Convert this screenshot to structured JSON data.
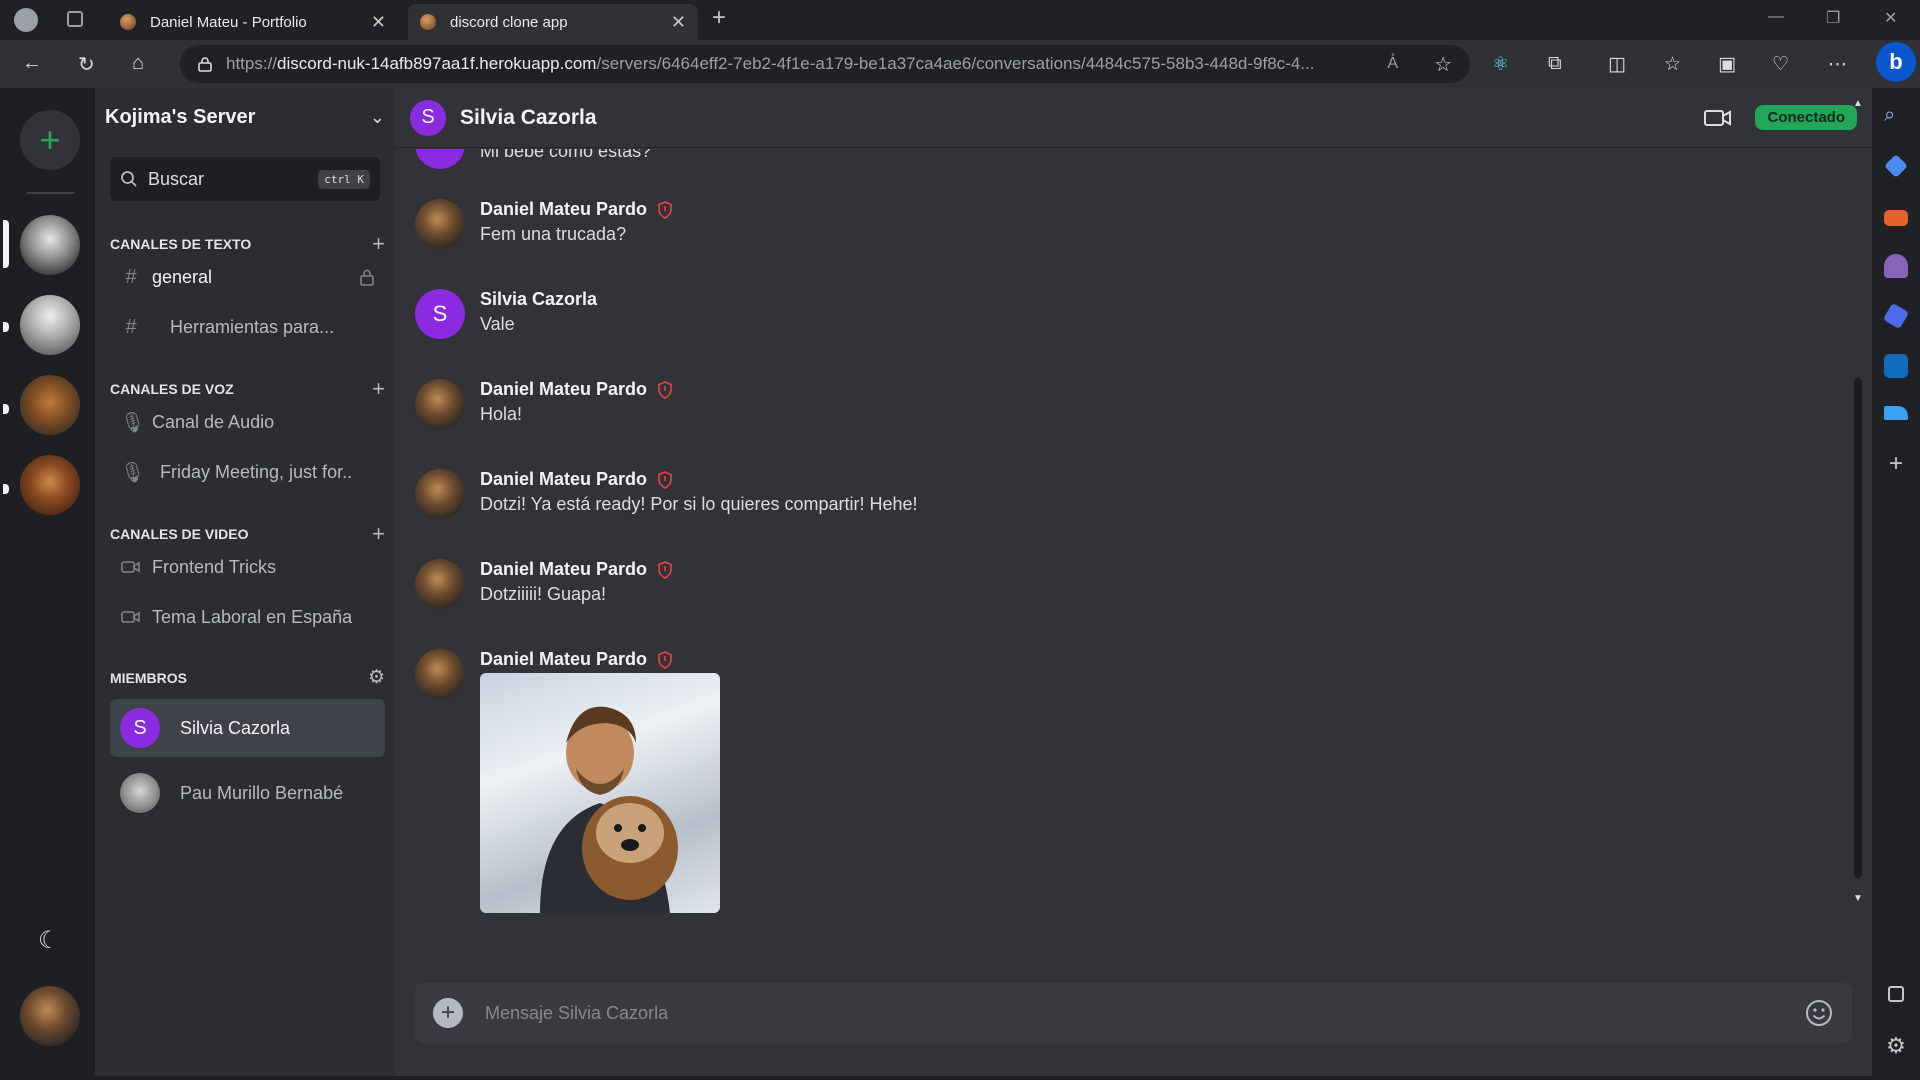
{
  "browser": {
    "tabs": [
      {
        "title": "Daniel Mateu - Portfolio"
      },
      {
        "title": "discord clone app"
      }
    ],
    "url_scheme": "https://",
    "url_host": "discord-nuk-14afb897aa1f.herokuapp.com",
    "url_path": "/servers/6464eff2-7eb2-4f1e-a179-be1a37ca4ae6/conversations/4484c575-58b3-448d-9f8c-4..."
  },
  "app": {
    "server_name": "Kojima's Server",
    "search": {
      "label": "Buscar",
      "shortcut": "ctrl K"
    },
    "sections": {
      "text": "CANALES DE TEXTO",
      "voice": "CANALES DE VOZ",
      "video": "CANALES DE VIDEO",
      "members": "MIEMBROS"
    },
    "text_channels": [
      {
        "name": "general"
      },
      {
        "name": "Herramientas para..."
      }
    ],
    "voice_channels": [
      {
        "name": "Canal de Audio"
      },
      {
        "name": "Friday Meeting, just for.."
      }
    ],
    "video_channels": [
      {
        "name": "Frontend Tricks"
      },
      {
        "name": "Tema Laboral en España"
      }
    ],
    "members": [
      {
        "name": "Silvia Cazorla",
        "initial": "S"
      },
      {
        "name": "Pau Murillo Bernabé"
      }
    ],
    "chat": {
      "title": "Silvia Cazorla",
      "initial": "S",
      "status": "Conectado",
      "partial_text": "Mi bebe como estas?",
      "messages": [
        {
          "author": "Daniel Mateu Pardo",
          "text": "Fem una trucada?",
          "admin": true
        },
        {
          "author": "Silvia Cazorla",
          "text": "Vale",
          "admin": false,
          "initial": "S"
        },
        {
          "author": "Daniel Mateu Pardo",
          "text": "Hola!",
          "admin": true
        },
        {
          "author": "Daniel Mateu Pardo",
          "text": "Dotzi! Ya está ready! Por si lo quieres compartir! Hehe!",
          "admin": true
        },
        {
          "author": "Daniel Mateu Pardo",
          "text": "Dotziiiii! Guapa!",
          "admin": true
        },
        {
          "author": "Daniel Mateu Pardo",
          "text": "",
          "admin": true,
          "attachment": "photo"
        }
      ],
      "composer_placeholder": "Mensaje Silvia Cazorla"
    }
  },
  "colors": {
    "accent_green": "#23a55a",
    "avatar_purple": "#8a2be2",
    "admin_red": "#f23f43"
  }
}
